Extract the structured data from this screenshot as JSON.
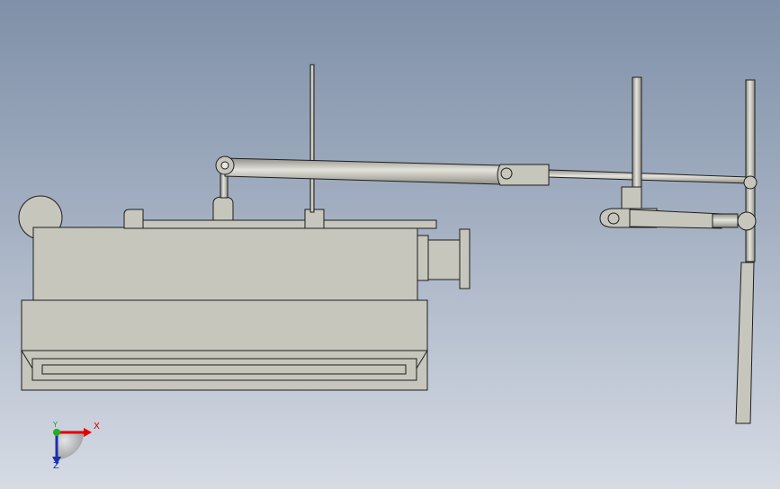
{
  "viewport": {
    "background_top": "#7f90a8",
    "background_bottom": "#d6dbe4"
  },
  "model": {
    "fill": "#c6c6bc",
    "edge": "#1e1e1e",
    "rod_highlight": "#e4e4dc",
    "rod_shadow": "#8f8f86"
  },
  "triad": {
    "x_label": "X",
    "y_label": "Y",
    "z_label": "Z",
    "x_color": "#e00000",
    "y_color": "#20b020",
    "z_color": "#1a2fb0"
  }
}
